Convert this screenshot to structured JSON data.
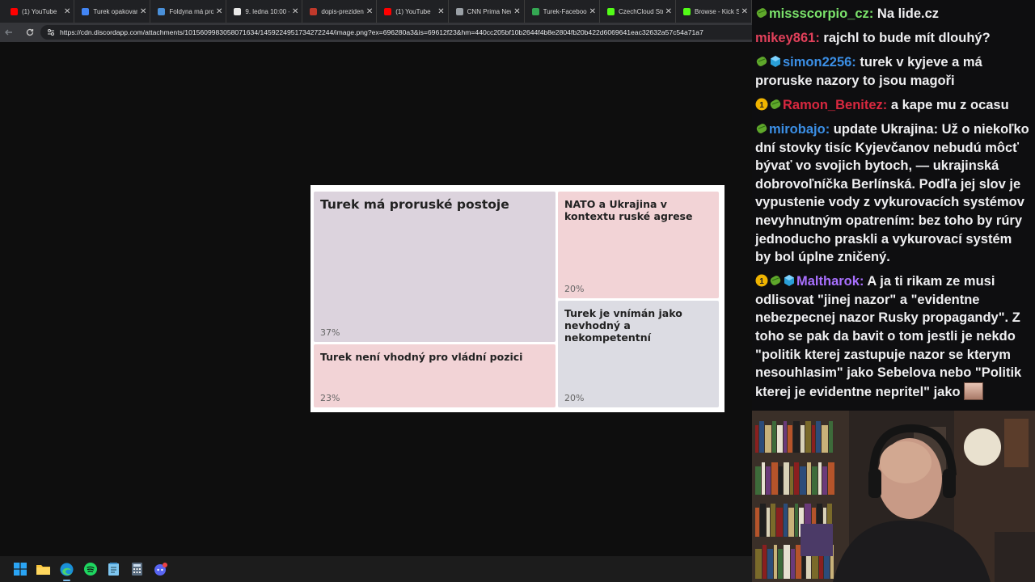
{
  "browser": {
    "tabs": [
      {
        "label": "(1) YouTube",
        "icon": "youtube-icon",
        "color": "#ff0000"
      },
      {
        "label": "Turek opakovan",
        "icon": "page-icon",
        "color": "#4285f4"
      },
      {
        "label": "Foldyna má pro",
        "icon": "page-icon",
        "color": "#4a90d9"
      },
      {
        "label": "9. ledna 10:00 -",
        "icon": "page-icon",
        "color": "#e8e8e8"
      },
      {
        "label": "dopis-preziden",
        "icon": "shield-icon",
        "color": "#c0392b"
      },
      {
        "label": "(1) YouTube",
        "icon": "youtube-icon",
        "color": "#ff0000"
      },
      {
        "label": "CNN Prima New",
        "icon": "globe-icon",
        "color": "#9aa0a6"
      },
      {
        "label": "Turek-Faceboo",
        "icon": "drive-icon",
        "color": "#34a853"
      },
      {
        "label": "CzechCloud Str",
        "icon": "kick-icon",
        "color": "#53fc18"
      },
      {
        "label": "Browse - Kick S",
        "icon": "kick-icon",
        "color": "#53fc18"
      }
    ],
    "url": "https://cdn.discordapp.com/attachments/1015609983058071634/1459224951734272244/image.png?ex=696280a3&is=69612f23&hm=440cc205bf10b2644f4b8e2804fb20b422d6069641eac32632a57c54a71a7"
  },
  "treemap": {
    "cells": [
      {
        "title": "Turek má proruské postoje",
        "pct": "37%",
        "color": "#dcd3dd"
      },
      {
        "title": "NATO a Ukrajina v kontextu ruské agrese",
        "pct": "20%",
        "color": "#f2d3d6"
      },
      {
        "title": "Turek není vhodný pro vládní pozici",
        "pct": "23%",
        "color": "#f2d3d6"
      },
      {
        "title": "Turek je vnímán jako nevhodný a nekompetentní",
        "pct": "20%",
        "color": "#dcdce3"
      }
    ]
  },
  "taskbar": {
    "icons": [
      "windows-start-icon",
      "file-explorer-icon",
      "edge-browser-icon",
      "spotify-icon",
      "notepad-icon",
      "calculator-icon",
      "discord-icon"
    ]
  },
  "chat": {
    "messages": [
      {
        "badges": [
          "green"
        ],
        "user": "missscorpio_cz",
        "color": "#7be36b",
        "text": "Na lide.cz"
      },
      {
        "badges": [],
        "user": "mikey861",
        "color": "#e0405a",
        "text": "rajchl to bude mít dlouhý?"
      },
      {
        "badges": [
          "green",
          "blue"
        ],
        "user": "simon2256",
        "color": "#3b8fe6",
        "text": "turek v kyjeve a má proruske nazory to jsou magoři"
      },
      {
        "badges": [
          "gold",
          "green"
        ],
        "user": "Ramon_Benitez",
        "color": "#d8283f",
        "text": "a kape mu z ocasu"
      },
      {
        "badges": [
          "green"
        ],
        "user": "mirobajo",
        "color": "#3b8fe6",
        "text": "update Ukrajina: Už o niekoľko dní stovky tisíc Kyjevčanov nebudú môcť bývať vo svojich bytoch, — ukrajinská dobrovoľníčka Berlínská. Podľa jej slov je vypustenie vody z vykurovacích systémov nevyhnutným opatrením: bez toho by rúry jednoducho praskli a vykurovací systém by bol úplne zničený."
      },
      {
        "badges": [
          "gold",
          "green",
          "blue"
        ],
        "user": "Maltharok",
        "color": "#a970ff",
        "text": "A ja ti rikam ze musi odlisovat \"jinej nazor\" a \"evidentne nebezpecnej nazor Rusky propagandy\". Z toho se pak da bavit o tom jestli je nekdo \"politik kterej zastupuje nazor se kterym nesouhlasim\" jako Sebelova nebo \"Politik kterej je evidentne nepritel\" jako",
        "emote": "face-emote"
      }
    ]
  }
}
